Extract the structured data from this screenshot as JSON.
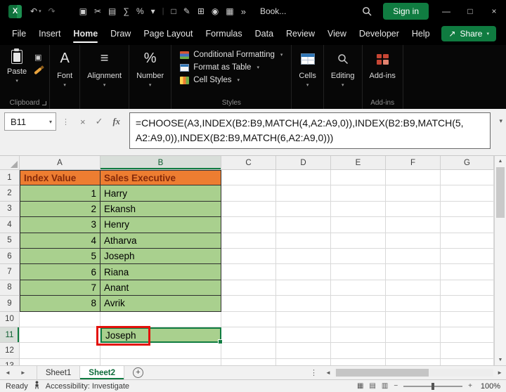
{
  "icons": {
    "dropdown": "▾",
    "minimize": "—",
    "maximize": "□",
    "close": "×",
    "divider": "|",
    "overflow": "»",
    "cancel": "×",
    "enter": "✓",
    "fx": "fx",
    "vdots": "⋮",
    "arrow_left": "◄",
    "arrow_right": "►",
    "arrow_up": "▲",
    "arrow_down": "▼",
    "zoom_out": "−",
    "zoom_in": "+",
    "share_arrow": "↗",
    "add": "+",
    "font_glyph": "A",
    "alignment_glyph": "≡",
    "number_glyph": "%",
    "copy_glyph": "▣",
    "view_normal": "▦",
    "view_page_layout": "▤",
    "view_page_break": "▥"
  },
  "title_bar": {
    "workbook_title": "Book...",
    "sign_in": "Sign in",
    "undo_glyph": "↶",
    "redo_glyph": "↷",
    "quick_access": [
      {
        "name": "copy-icon",
        "glyph": "▣"
      },
      {
        "name": "cut-icon",
        "glyph": "✂"
      },
      {
        "name": "notebook-icon",
        "glyph": "▤"
      },
      {
        "name": "autosum-icon",
        "glyph": "∑"
      },
      {
        "name": "percent-style-icon",
        "glyph": "%"
      },
      {
        "name": "more-commands-icon",
        "glyph": "▾"
      }
    ],
    "quick_access_2": [
      {
        "name": "new-file-icon",
        "glyph": "□"
      },
      {
        "name": "pen-icon",
        "glyph": "✎"
      },
      {
        "name": "merge-icon",
        "glyph": "⊞"
      },
      {
        "name": "camera-icon",
        "glyph": "◉"
      },
      {
        "name": "borders-icon",
        "glyph": "▦"
      }
    ]
  },
  "menu": {
    "tabs": [
      "File",
      "Insert",
      "Home",
      "Draw",
      "Page Layout",
      "Formulas",
      "Data",
      "Review",
      "View",
      "Developer",
      "Help"
    ],
    "active": "Home",
    "share": "Share"
  },
  "ribbon": {
    "paste": "Paste",
    "clipboard_group": "Clipboard",
    "font_group": "Font",
    "alignment_group": "Alignment",
    "number_group": "Number",
    "styles_group": "Styles",
    "conditional_formatting": "Conditional Formatting",
    "format_as_table": "Format as Table",
    "cell_styles": "Cell Styles",
    "cells_group": "Cells",
    "editing_group": "Editing",
    "addins_button": "Add-ins",
    "addins_group": "Add-ins"
  },
  "formula_bar": {
    "name_box": "B11",
    "formula_line1": "=CHOOSE(A3,INDEX(B2:B9,MATCH(4,A2:A9,0)),INDEX(B2:B9,MATCH(5,",
    "formula_line2": "A2:A9,0)),INDEX(B2:B9,MATCH(6,A2:A9,0)))"
  },
  "grid": {
    "column_headers": [
      "A",
      "B",
      "C",
      "D",
      "E",
      "F",
      "G"
    ],
    "selected_column": "B",
    "selected_row": 11,
    "visible_rows": 13,
    "table": {
      "header": {
        "A": "Index Value",
        "B": "Sales Executive"
      },
      "rows": [
        {
          "index": "1",
          "name": "Harry"
        },
        {
          "index": "2",
          "name": "Ekansh"
        },
        {
          "index": "3",
          "name": "Henry"
        },
        {
          "index": "4",
          "name": "Atharva"
        },
        {
          "index": "5",
          "name": "Joseph"
        },
        {
          "index": "6",
          "name": "Riana"
        },
        {
          "index": "7",
          "name": "Anant"
        },
        {
          "index": "8",
          "name": "Avrik"
        }
      ]
    },
    "result_cell": {
      "address": "B11",
      "value": "Joseph"
    }
  },
  "sheet_bar": {
    "sheets": [
      "Sheet1",
      "Sheet2"
    ],
    "active_sheet": "Sheet2"
  },
  "status_bar": {
    "mode": "Ready",
    "accessibility": "Accessibility: Investigate",
    "zoom_level": "100%"
  }
}
